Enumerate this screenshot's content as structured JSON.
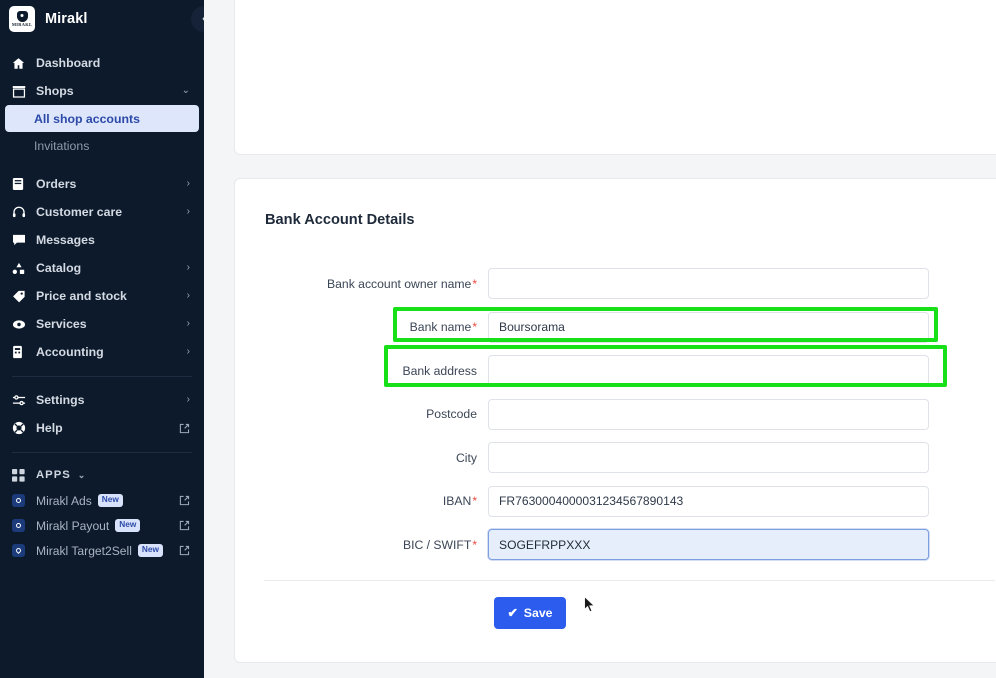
{
  "sidebar": {
    "brand": {
      "name": "Mirakl",
      "logo_wordmark": "MIRAKL"
    },
    "collapse_icon": "‹",
    "nav": [
      {
        "label": "Dashboard",
        "icon": "home-icon",
        "chevron": ""
      },
      {
        "label": "Shops",
        "icon": "shop-icon",
        "chevron": "⌄"
      },
      {
        "label": "All shop accounts",
        "icon": "",
        "chevron": "",
        "sub": true,
        "active": true
      },
      {
        "label": "Invitations",
        "icon": "",
        "chevron": "",
        "sub": true,
        "active": false
      },
      {
        "label": "Orders",
        "icon": "orders-icon",
        "chevron": "›"
      },
      {
        "label": "Customer care",
        "icon": "headset-icon",
        "chevron": "›"
      },
      {
        "label": "Messages",
        "icon": "message-icon",
        "chevron": ""
      },
      {
        "label": "Catalog",
        "icon": "catalog-icon",
        "chevron": "›"
      },
      {
        "label": "Price and stock",
        "icon": "tag-icon",
        "chevron": "›"
      },
      {
        "label": "Services",
        "icon": "services-icon",
        "chevron": "›"
      },
      {
        "label": "Accounting",
        "icon": "accounting-icon",
        "chevron": "›"
      },
      {
        "label": "Settings",
        "icon": "settings-icon",
        "chevron": "›"
      },
      {
        "label": "Help",
        "icon": "help-icon",
        "chevron": "",
        "external": true
      }
    ],
    "apps_section": {
      "title": "APPS",
      "chevron": "⌄",
      "items": [
        {
          "label": "Mirakl Ads",
          "badge": "New",
          "icon": "app-dot-icon"
        },
        {
          "label": "Mirakl Payout",
          "badge": "New",
          "icon": "app-dot-icon"
        },
        {
          "label": "Mirakl Target2Sell",
          "badge": "New",
          "icon": "app-pin-icon"
        }
      ]
    }
  },
  "main": {
    "panel_title": "Bank Account Details",
    "fields": [
      {
        "label": "Bank account owner name",
        "required": true,
        "value": "",
        "placeholder": ""
      },
      {
        "label": "Bank name",
        "required": true,
        "value": "Boursorama",
        "placeholder": ""
      },
      {
        "label": "Bank address",
        "required": false,
        "value": "",
        "placeholder": ""
      },
      {
        "label": "Postcode",
        "required": false,
        "value": "",
        "placeholder": ""
      },
      {
        "label": "City",
        "required": false,
        "value": "",
        "placeholder": ""
      },
      {
        "label": "IBAN",
        "required": true,
        "value": "FR7630004000031234567890143",
        "placeholder": "",
        "highlighted": true
      },
      {
        "label": "BIC / SWIFT",
        "required": true,
        "value": "SOGEFRPPXXX",
        "placeholder": "",
        "highlighted": true,
        "focused": true
      }
    ],
    "save_label": "Save",
    "save_icon": "✔"
  },
  "colors": {
    "sidebar_bg": "#0c1a2b",
    "active_item_bg": "#dde6fb",
    "active_item_text": "#2c49a8",
    "accent_blue": "#2b5ced",
    "required_red": "#e8493f",
    "highlight_green": "#18e018",
    "focus_field_bg": "#e6eefc",
    "page_bg": "#f4f5f7"
  }
}
